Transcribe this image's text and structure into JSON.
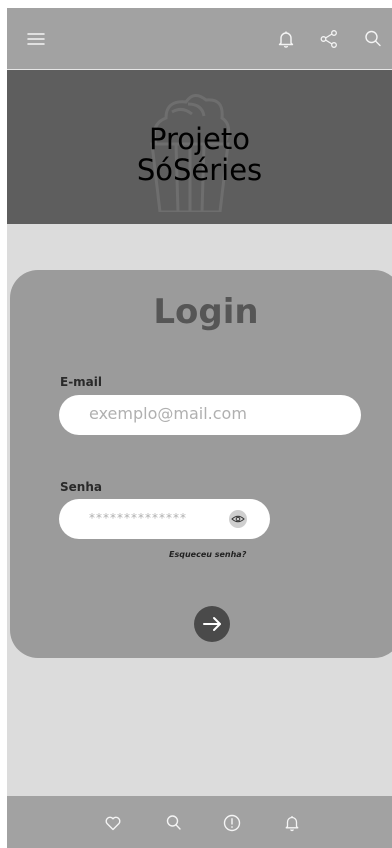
{
  "brand": {
    "line1": "Projeto",
    "line2": "SóSéries"
  },
  "login": {
    "title": "Login",
    "email_label": "E-mail",
    "email_placeholder": "exemplo@mail.com",
    "password_label": "Senha",
    "password_value": "**************",
    "forgot_link": "Esqueceu senha?"
  },
  "icons": {
    "top": [
      "menu-icon",
      "bell-icon",
      "share-icon",
      "search-icon"
    ],
    "bottom": [
      "heart-icon",
      "search-icon",
      "alert-icon",
      "bell-icon"
    ],
    "submit": "arrow-right-icon",
    "password_toggle": "eye-icon"
  },
  "colors": {
    "bars": "#a2a2a2",
    "banner": "#5e5e5e",
    "card": "#9b9b9b",
    "background": "#dcdcdc",
    "submit_button": "#4a4a4a"
  }
}
